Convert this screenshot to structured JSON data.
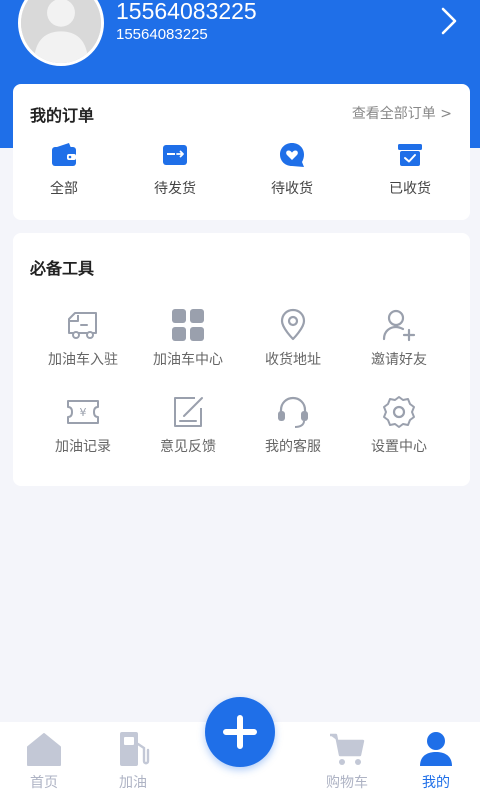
{
  "profile": {
    "name": "15564083225",
    "phone": "15564083225",
    "avatar_icon": "user-avatar-placeholder",
    "chevron_icon": "chevron-right-icon"
  },
  "orders": {
    "title": "我的订单",
    "view_all": "查看全部订单 >",
    "items": [
      {
        "label": "全部",
        "icon": "wallet-icon"
      },
      {
        "label": "待发货",
        "icon": "shipping-card-icon"
      },
      {
        "label": "待收货",
        "icon": "heart-chat-icon"
      },
      {
        "label": "已收货",
        "icon": "box-check-icon"
      }
    ]
  },
  "tools": {
    "title": "必备工具",
    "items": [
      {
        "label": "加油车入驻",
        "icon": "truck-icon"
      },
      {
        "label": "加油车中心",
        "icon": "grid-icon"
      },
      {
        "label": "收货地址",
        "icon": "location-pin-icon"
      },
      {
        "label": "邀请好友",
        "icon": "add-user-icon"
      },
      {
        "label": "加油记录",
        "icon": "yen-ticket-icon"
      },
      {
        "label": "意见反馈",
        "icon": "edit-note-icon"
      },
      {
        "label": "我的客服",
        "icon": "headset-icon"
      },
      {
        "label": "设置中心",
        "icon": "gear-icon"
      }
    ]
  },
  "tabbar": {
    "home": "首页",
    "fuel": "加油",
    "cart": "购物车",
    "mine": "我的",
    "active": "mine",
    "fab_icon": "plus-icon"
  },
  "colors": {
    "primary": "#1f6fe8",
    "inactive": "#aeb3c4",
    "icon_gray": "#9aa0ad"
  }
}
